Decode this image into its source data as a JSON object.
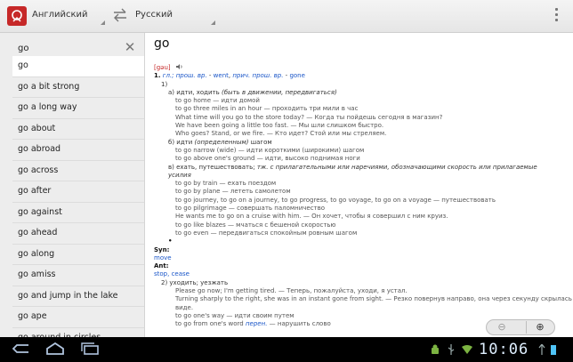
{
  "actionbar": {
    "source_lang": "Английский",
    "target_lang": "Русский",
    "app_icon": "dictionary-logo-icon",
    "swap_icon": "swap-arrows-icon",
    "menu_icon": "overflow-menu-icon"
  },
  "search": {
    "value": "go",
    "clear_icon": "close-icon"
  },
  "word_list": [
    "go",
    "go a bit strong",
    "go a long way",
    "go about",
    "go abroad",
    "go across",
    "go after",
    "go against",
    "go ahead",
    "go along",
    "go amiss",
    "go and jump in the lake",
    "go ape",
    "go around in circles"
  ],
  "article": {
    "headword": "go",
    "transcription": "[gəu]",
    "sound_icon": "speaker-icon",
    "sense1_num": "1.",
    "sense1_gram": "гл.; прош. вр.",
    "past": "went",
    "pp_label": "прич. прош. вр.",
    "pp": "gone",
    "sub1": "1)",
    "a_label": "а) идти, ходить",
    "a_note": "(быть в движении, передвигаться)",
    "a_examples": [
      "to go home — идти домой",
      "to go three miles in an hour — проходить три мили в час",
      "What time will you go to the store today? — Когда ты пойдешь сегодня в магазин?",
      "We have been going a little too fast. — Мы шли слишком быстро.",
      "Who goes? Stand, or we fire. — Кто идет? Стой или мы стреляем."
    ],
    "b_label": "б) идти",
    "b_note": "(определенным)",
    "b_tail": "шагом",
    "b_examples": [
      "to go narrow (wide) — идти короткими (широкими) шагом",
      "to go above one's ground — идти, высоко поднимая ноги"
    ],
    "v_label": "в) ехать, путешествовать;",
    "v_note": "тж. с прилагательными или наречиями, обозначающими скорость или прилагаемые",
    "v_note2": "усилия",
    "v_examples": [
      "to go by train — ехать поездом",
      "to go by plane — лететь самолетом",
      "to go journey, to go on a journey, to go progress, to go voyage, to go on a voyage — путешествовать",
      "to go pilgrimage — совершать паломничество",
      "He wants me to go on a cruise with him. — Он хочет, чтобы я совершил с ним круиз.",
      "to go like blazes — мчаться с бешеной скоростью",
      "to go even — передвигаться спокойным ровным шагом"
    ],
    "bullet": "•",
    "syn_label": "Syn:",
    "syn": "move",
    "ant_label": "Ant:",
    "ant": "stop, cease",
    "sub2": "2) уходить; уезжать",
    "sub2_examples": [
      "Please go now; I'm getting tired. — Теперь, пожалуйста, уходи, я устал.",
      "Turning sharply to the right, she was in an instant gone from sight. — Резко повернув направо, она через секунду скрылась из",
      "виде.",
      "to go one's way — идти своим путем"
    ],
    "last_ex_a": "to go from one's word",
    "last_ex_b": "перен.",
    "last_ex_c": "— нарушить слово"
  },
  "zoom": {
    "out_icon": "zoom-out-icon",
    "in_icon": "zoom-in-icon"
  },
  "sysbar": {
    "clock": "10:06",
    "back_icon": "back-icon",
    "home_icon": "home-icon",
    "recent_icon": "recent-apps-icon",
    "android_icon": "android-debug-icon",
    "usb_icon": "usb-icon",
    "wifi_icon": "wifi-icon",
    "battery_icon": "battery-icon"
  },
  "colors": {
    "accent": "#c62828",
    "link": "#1a56c8",
    "sysbar": "#000000"
  }
}
